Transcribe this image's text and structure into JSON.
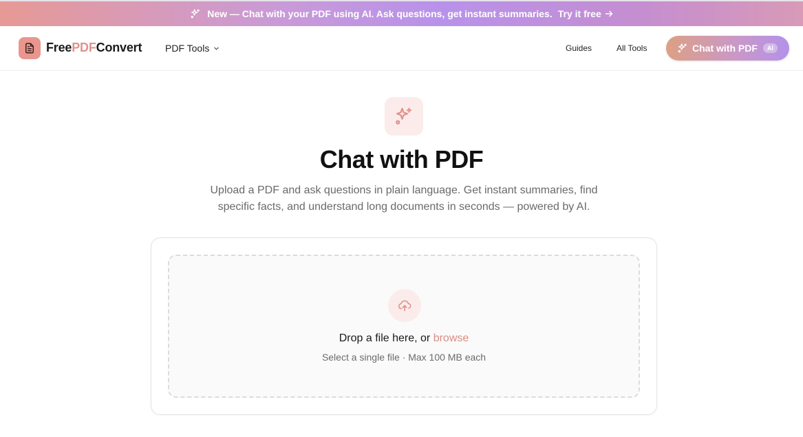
{
  "announcement": {
    "message": "New — Chat with your PDF using AI. Ask questions, get instant summaries.",
    "cta_label": "Try it free",
    "icon": "sparkles-icon",
    "arrow_icon": "arrow-right-icon"
  },
  "nav": {
    "logo": {
      "part1": "Free",
      "part2": "PDF",
      "part3": "Convert",
      "icon": "document-icon"
    },
    "pdf_tools_label": "PDF Tools",
    "links": [
      "Guides",
      "All Tools"
    ],
    "cta": {
      "label": "Chat with PDF",
      "badge": "AI",
      "icon": "sparkles-icon"
    }
  },
  "hero": {
    "icon": "sparkles-icon",
    "title": "Chat with PDF",
    "subtitle": "Upload a PDF and ask questions in plain language. Get instant summaries, find specific facts, and understand long documents in seconds — powered by AI."
  },
  "upload": {
    "icon": "cloud-upload-icon",
    "prompt": "Drop a file here, or",
    "browse_label": "browse",
    "hint": "Select a single file · Max 100 MB each"
  },
  "colors": {
    "accent": "#e0938c",
    "accent_bg": "#fbeceb",
    "cta_gradient_start": "#dca083",
    "cta_gradient_end": "#b392ea"
  }
}
